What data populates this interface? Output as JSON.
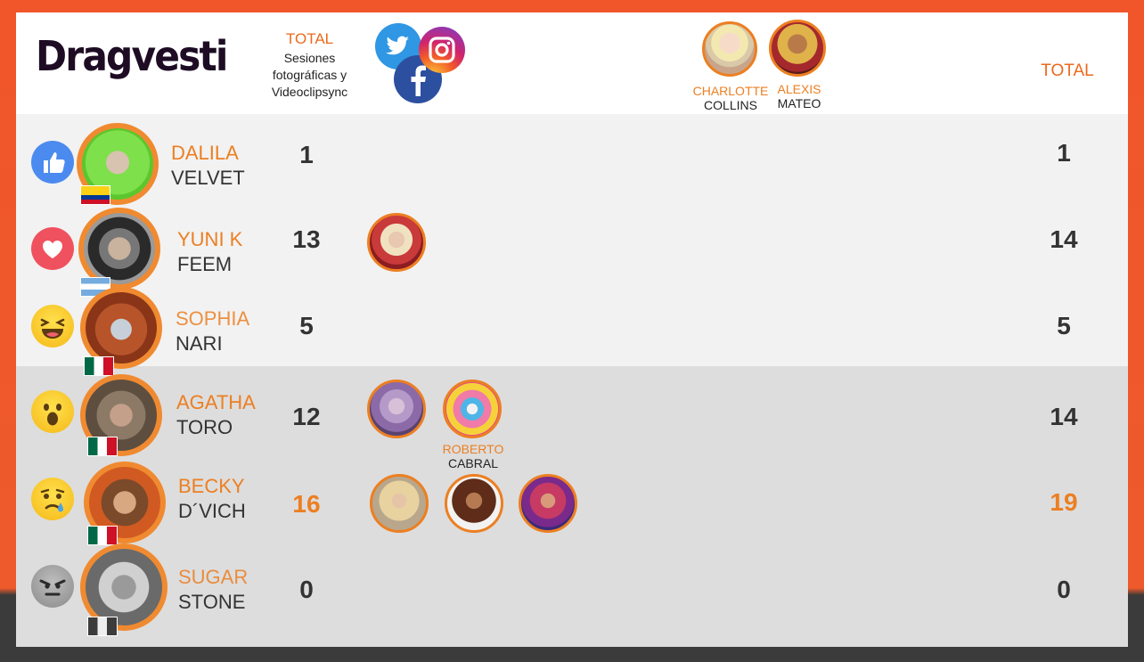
{
  "brand": {
    "logo": "Dragvesti"
  },
  "header": {
    "total_label": "TOTAL",
    "total_sub_lines": [
      "Sesiones",
      "fotográficas y",
      "Videoclipsync"
    ],
    "right_total_label": "TOTAL",
    "social_icons": [
      "twitter-icon",
      "facebook-icon",
      "instagram-icon"
    ],
    "judges": [
      {
        "first": "CHARLOTTE",
        "last": "COLLINS"
      },
      {
        "first": "ALEXIS",
        "last": "MATEO"
      }
    ]
  },
  "colors": {
    "accent": "#ec7f22",
    "frame": "#f0562a",
    "row_light": "#f2f2f2",
    "row_dark": "#dddddd"
  },
  "contestants": [
    {
      "first": "DALILA",
      "last": "VELVET",
      "reaction": "like",
      "flag": "colombia",
      "sessions": "1",
      "total": "1",
      "highlight": false
    },
    {
      "first": "YUNI K",
      "last": "FEEM",
      "reaction": "love",
      "flag": "argentina",
      "sessions": "13",
      "total": "14",
      "highlight": false
    },
    {
      "first": "SOPHIA",
      "last": "NARI",
      "reaction": "haha",
      "flag": "mexico",
      "sessions": "5",
      "total": "5",
      "highlight": false
    },
    {
      "first": "AGATHA",
      "last": "TORO",
      "reaction": "wow",
      "flag": "mexico",
      "sessions": "12",
      "total": "14",
      "highlight": false
    },
    {
      "first": "BECKY",
      "last": "D´VICH",
      "reaction": "sad",
      "flag": "mexico",
      "sessions": "16",
      "total": "19",
      "highlight": true
    },
    {
      "first": "SUGAR",
      "last": "STONE",
      "reaction": "angry",
      "flag": "mexico",
      "sessions": "0",
      "total": "0",
      "highlight": false
    }
  ],
  "winner_label": {
    "first": "ROBERTO",
    "last": "CABRAL"
  }
}
